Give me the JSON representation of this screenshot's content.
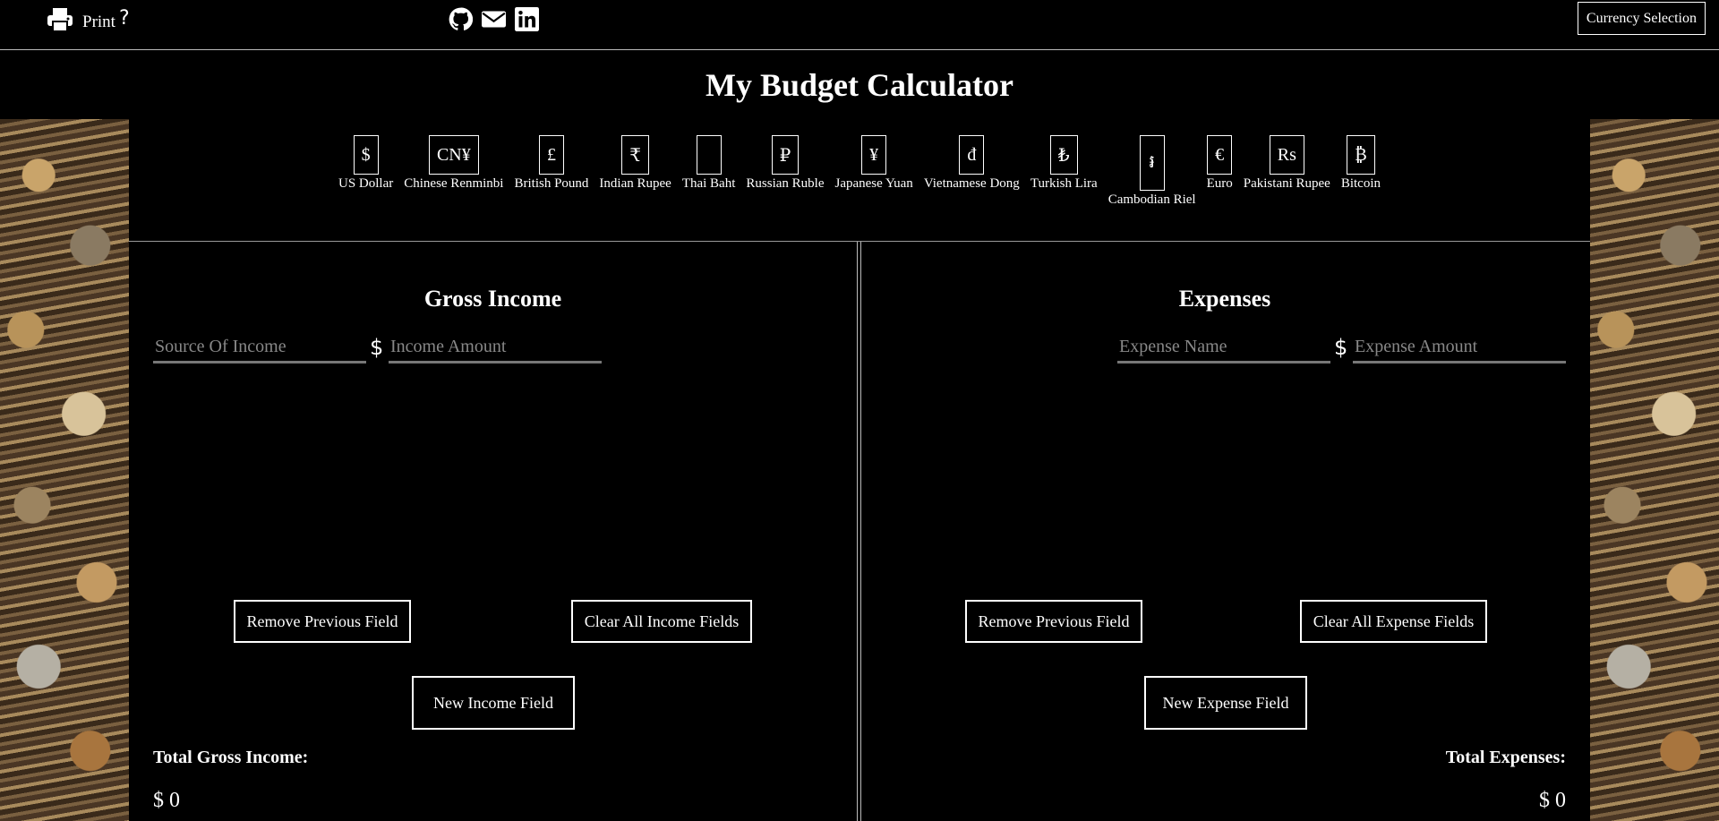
{
  "header": {
    "print_label": "Print",
    "help_label": "?",
    "currency_selection_label": "Currency Selection"
  },
  "title": "My Budget Calculator",
  "currencies": [
    {
      "symbol": "$",
      "name": "US Dollar"
    },
    {
      "symbol": "CN¥",
      "name": "Chinese Renminbi"
    },
    {
      "symbol": "£",
      "name": "British Pound"
    },
    {
      "symbol": "₹",
      "name": "Indian Rupee"
    },
    {
      "symbol": "",
      "name": "Thai Baht"
    },
    {
      "symbol": "₽",
      "name": "Russian Ruble"
    },
    {
      "symbol": "¥",
      "name": "Japanese Yuan"
    },
    {
      "symbol": "đ",
      "name": "Vietnamese Dong"
    },
    {
      "symbol": "₺",
      "name": "Turkish Lira"
    },
    {
      "symbol": "៛",
      "name": "Cambodian Riel"
    },
    {
      "symbol": "€",
      "name": "Euro"
    },
    {
      "symbol": "Rs",
      "name": "Pakistani Rupee"
    },
    {
      "symbol": "₿",
      "name": "Bitcoin"
    }
  ],
  "income": {
    "title": "Gross Income",
    "source_placeholder": "Source Of Income",
    "currency_symbol": "$",
    "amount_placeholder": "Income Amount",
    "remove_button": "Remove Previous Field",
    "clear_button": "Clear All Income Fields",
    "new_button": "New Income Field",
    "total_label": "Total Gross Income:",
    "total_value": "$ 0"
  },
  "expenses": {
    "title": "Expenses",
    "name_placeholder": "Expense Name",
    "currency_symbol": "$",
    "amount_placeholder": "Expense Amount",
    "remove_button": "Remove Previous Field",
    "clear_button": "Clear All Expense Fields",
    "new_button": "New Expense Field",
    "total_label": "Total Expenses:",
    "total_value": "$ 0"
  },
  "icons": [
    "printer-icon",
    "github-icon",
    "envelope-icon",
    "linkedin-icon"
  ]
}
